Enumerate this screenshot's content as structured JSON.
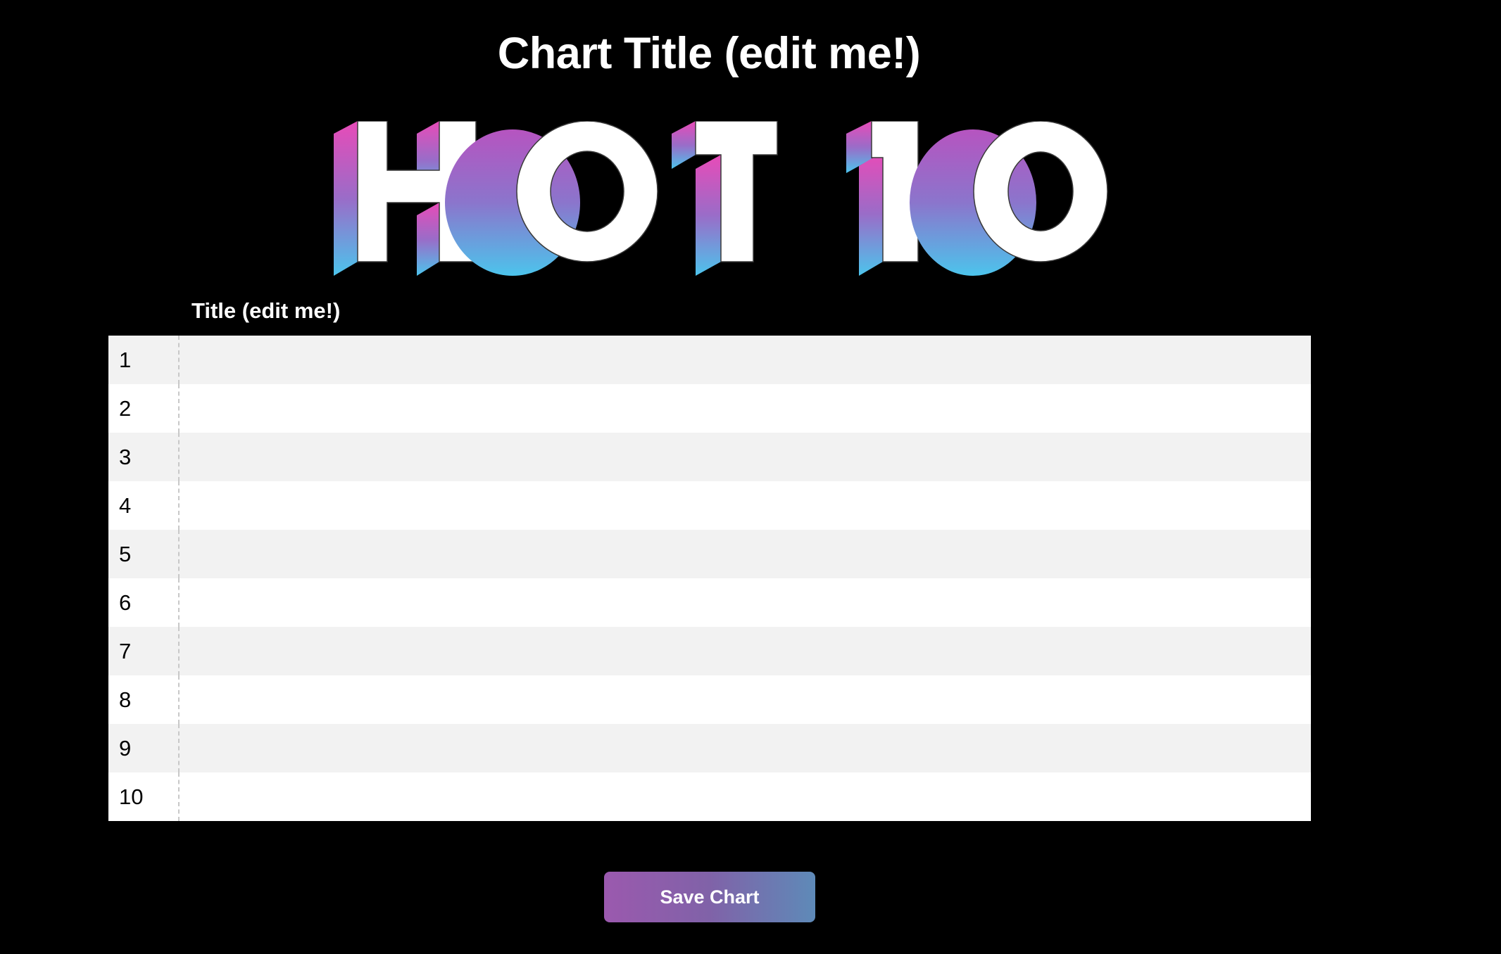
{
  "header": {
    "title": "Chart Title (edit me!)"
  },
  "logo": {
    "text": "HOT 10",
    "colors": {
      "top": "#e84bb8",
      "middle": "#9a6cc8",
      "bottom": "#4cc4ec",
      "letter_fill": "#ffffff",
      "letter_outline": "#3a3a3a"
    }
  },
  "table": {
    "column_header": "Title (edit me!)",
    "rows": [
      {
        "rank": "1",
        "title": ""
      },
      {
        "rank": "2",
        "title": ""
      },
      {
        "rank": "3",
        "title": ""
      },
      {
        "rank": "4",
        "title": ""
      },
      {
        "rank": "5",
        "title": ""
      },
      {
        "rank": "6",
        "title": ""
      },
      {
        "rank": "7",
        "title": ""
      },
      {
        "rank": "8",
        "title": ""
      },
      {
        "rank": "9",
        "title": ""
      },
      {
        "rank": "10",
        "title": ""
      }
    ]
  },
  "actions": {
    "save_label": "Save Chart"
  },
  "colors": {
    "background": "#000000",
    "row_alt": "#f2f2f2",
    "row": "#ffffff",
    "button_gradient_start": "#9b59ae",
    "button_gradient_end": "#5e8ab8"
  }
}
